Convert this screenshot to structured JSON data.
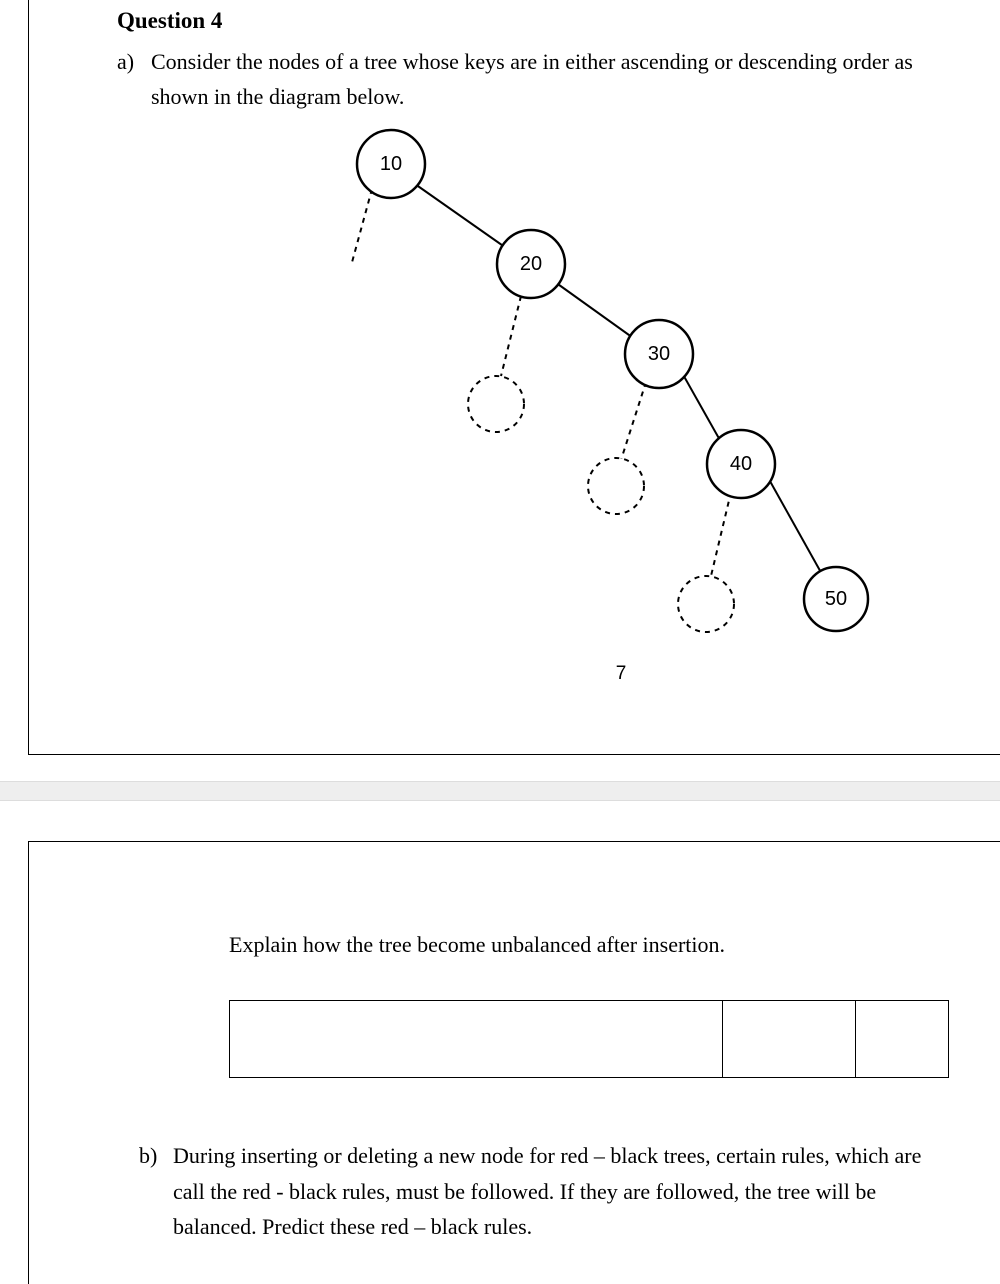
{
  "question": {
    "title": "Question 4",
    "part_a": {
      "label": "a)",
      "text": "Consider the nodes of a tree whose keys are in either ascending or descending order as shown in the diagram below."
    },
    "part_b": {
      "label": "b)",
      "text": "During inserting or deleting a new node for red – black trees, certain rules, which are call the red - black rules, must be followed. If they are followed, the tree will be balanced. Predict these red – black rules."
    },
    "explain_prompt": "Explain how the tree become unbalanced after insertion."
  },
  "tree": {
    "nodes": [
      "10",
      "20",
      "30",
      "40",
      "50"
    ],
    "page_number": "7"
  }
}
